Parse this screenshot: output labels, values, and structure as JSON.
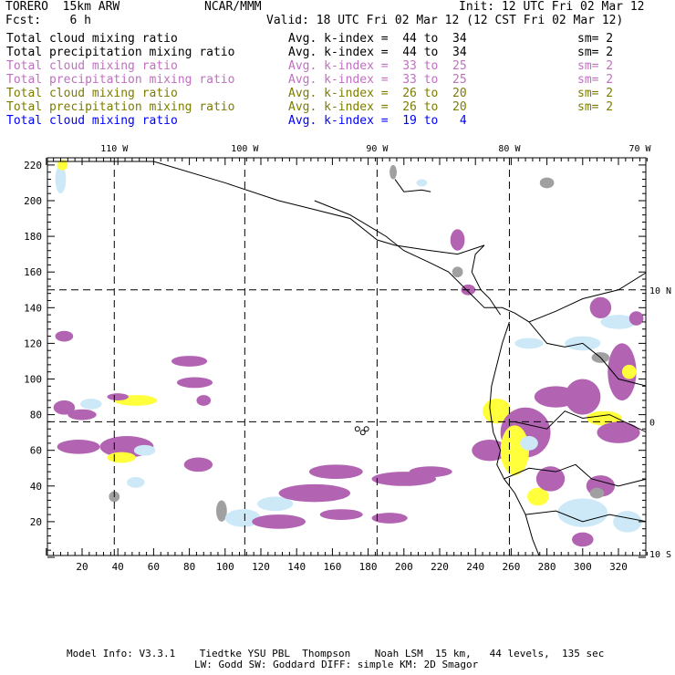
{
  "header": {
    "title": "TORERO  15km ARW",
    "org": "NCAR/MMM",
    "init": "Init: 12 UTC Fri 02 Mar 12",
    "fcst": "Fcst:    6 h",
    "valid": "Valid: 18 UTC Fri 02 Mar 12 (12 CST Fri 02 Mar 12)"
  },
  "legend": [
    {
      "field": "Total cloud mixing ratio",
      "range": "Avg. k-index =  44 to  34",
      "sm": "sm= 2",
      "color": "#000000"
    },
    {
      "field": "Total precipitation mixing ratio",
      "range": "Avg. k-index =  44 to  34",
      "sm": "sm= 2",
      "color": "#000000"
    },
    {
      "field": "Total cloud mixing ratio",
      "range": "Avg. k-index =  33 to  25",
      "sm": "sm= 2",
      "color": "#c070c0"
    },
    {
      "field": "Total precipitation mixing ratio",
      "range": "Avg. k-index =  33 to  25",
      "sm": "sm= 2",
      "color": "#c070c0"
    },
    {
      "field": "Total cloud mixing ratio",
      "range": "Avg. k-index =  26 to  20",
      "sm": "sm= 2",
      "color": "#7c7c00"
    },
    {
      "field": "Total precipitation mixing ratio",
      "range": "Avg. k-index =  26 to  20",
      "sm": "sm= 2",
      "color": "#7c7c00"
    },
    {
      "field": "Total cloud mixing ratio",
      "range": "Avg. k-index =  19 to   4",
      "sm": "",
      "color": "#0000ff"
    }
  ],
  "chart_data": {
    "type": "heatmap",
    "x_ticks": [
      20,
      40,
      60,
      80,
      100,
      120,
      140,
      160,
      180,
      200,
      220,
      240,
      260,
      280,
      300,
      320
    ],
    "y_ticks": [
      20,
      40,
      60,
      80,
      100,
      120,
      140,
      160,
      180,
      200,
      220
    ],
    "xlim": [
      0,
      336
    ],
    "ylim": [
      0,
      223
    ],
    "lon_labels": [
      {
        "label": "110 W",
        "x": 38
      },
      {
        "label": "100 W",
        "x": 111
      },
      {
        "label": "90 W",
        "x": 185
      },
      {
        "label": "80 W",
        "x": 259
      },
      {
        "label": "70 W",
        "x": 332
      }
    ],
    "lat_labels": [
      {
        "label": "10 N",
        "y": 150
      },
      {
        "label": "0",
        "y": 76
      },
      {
        "label": "10 S",
        "y": 2
      }
    ],
    "grid_lines_x": [
      38,
      111,
      185,
      259
    ],
    "grid_lines_y": [
      150,
      76
    ],
    "colors": {
      "purple": "#b264b2",
      "yellow": "#ffff3c",
      "blue": "#cde9f8",
      "gray": "#a0a0a0"
    },
    "fields": [
      {
        "c": "purple",
        "x": 10,
        "y": 84,
        "rx": 6,
        "ry": 4
      },
      {
        "c": "purple",
        "x": 20,
        "y": 80,
        "rx": 8,
        "ry": 3
      },
      {
        "c": "blue",
        "x": 25,
        "y": 86,
        "rx": 6,
        "ry": 3
      },
      {
        "c": "yellow",
        "x": 50,
        "y": 88,
        "rx": 12,
        "ry": 3
      },
      {
        "c": "purple",
        "x": 40,
        "y": 90,
        "rx": 6,
        "ry": 2
      },
      {
        "c": "purple",
        "x": 10,
        "y": 124,
        "rx": 5,
        "ry": 3
      },
      {
        "c": "purple",
        "x": 80,
        "y": 110,
        "rx": 10,
        "ry": 3
      },
      {
        "c": "purple",
        "x": 83,
        "y": 98,
        "rx": 10,
        "ry": 3
      },
      {
        "c": "purple",
        "x": 88,
        "y": 88,
        "rx": 4,
        "ry": 3
      },
      {
        "c": "purple",
        "x": 18,
        "y": 62,
        "rx": 12,
        "ry": 4
      },
      {
        "c": "purple",
        "x": 45,
        "y": 62,
        "rx": 15,
        "ry": 6
      },
      {
        "c": "yellow",
        "x": 42,
        "y": 56,
        "rx": 8,
        "ry": 3
      },
      {
        "c": "blue",
        "x": 55,
        "y": 60,
        "rx": 6,
        "ry": 3
      },
      {
        "c": "blue",
        "x": 50,
        "y": 42,
        "rx": 5,
        "ry": 3
      },
      {
        "c": "purple",
        "x": 85,
        "y": 52,
        "rx": 8,
        "ry": 4
      },
      {
        "c": "gray",
        "x": 38,
        "y": 34,
        "rx": 3,
        "ry": 3
      },
      {
        "c": "gray",
        "x": 98,
        "y": 26,
        "rx": 3,
        "ry": 6
      },
      {
        "c": "blue",
        "x": 110,
        "y": 22,
        "rx": 10,
        "ry": 5
      },
      {
        "c": "blue",
        "x": 128,
        "y": 30,
        "rx": 10,
        "ry": 4
      },
      {
        "c": "purple",
        "x": 150,
        "y": 36,
        "rx": 20,
        "ry": 5
      },
      {
        "c": "purple",
        "x": 130,
        "y": 20,
        "rx": 15,
        "ry": 4
      },
      {
        "c": "purple",
        "x": 165,
        "y": 24,
        "rx": 12,
        "ry": 3
      },
      {
        "c": "purple",
        "x": 200,
        "y": 44,
        "rx": 18,
        "ry": 4
      },
      {
        "c": "purple",
        "x": 215,
        "y": 48,
        "rx": 12,
        "ry": 3
      },
      {
        "c": "purple",
        "x": 162,
        "y": 48,
        "rx": 15,
        "ry": 4
      },
      {
        "c": "purple",
        "x": 192,
        "y": 22,
        "rx": 10,
        "ry": 3
      },
      {
        "c": "purple",
        "x": 248,
        "y": 60,
        "rx": 10,
        "ry": 6
      },
      {
        "c": "yellow",
        "x": 252,
        "y": 82,
        "rx": 8,
        "ry": 7
      },
      {
        "c": "purple",
        "x": 268,
        "y": 70,
        "rx": 14,
        "ry": 14
      },
      {
        "c": "yellow",
        "x": 262,
        "y": 60,
        "rx": 8,
        "ry": 14
      },
      {
        "c": "blue",
        "x": 270,
        "y": 64,
        "rx": 5,
        "ry": 4
      },
      {
        "c": "purple",
        "x": 285,
        "y": 90,
        "rx": 12,
        "ry": 6
      },
      {
        "c": "yellow",
        "x": 275,
        "y": 34,
        "rx": 6,
        "ry": 5
      },
      {
        "c": "purple",
        "x": 282,
        "y": 44,
        "rx": 8,
        "ry": 7
      },
      {
        "c": "purple",
        "x": 300,
        "y": 90,
        "rx": 10,
        "ry": 10
      },
      {
        "c": "blue",
        "x": 300,
        "y": 120,
        "rx": 10,
        "ry": 4
      },
      {
        "c": "purple",
        "x": 322,
        "y": 104,
        "rx": 8,
        "ry": 16
      },
      {
        "c": "yellow",
        "x": 326,
        "y": 104,
        "rx": 4,
        "ry": 4
      },
      {
        "c": "yellow",
        "x": 312,
        "y": 78,
        "rx": 10,
        "ry": 4
      },
      {
        "c": "purple",
        "x": 320,
        "y": 70,
        "rx": 12,
        "ry": 6
      },
      {
        "c": "blue",
        "x": 270,
        "y": 120,
        "rx": 8,
        "ry": 3
      },
      {
        "c": "blue",
        "x": 320,
        "y": 132,
        "rx": 10,
        "ry": 4
      },
      {
        "c": "gray",
        "x": 310,
        "y": 112,
        "rx": 5,
        "ry": 3
      },
      {
        "c": "purple",
        "x": 330,
        "y": 134,
        "rx": 4,
        "ry": 4
      },
      {
        "c": "purple",
        "x": 310,
        "y": 140,
        "rx": 6,
        "ry": 6
      },
      {
        "c": "purple",
        "x": 310,
        "y": 40,
        "rx": 8,
        "ry": 6
      },
      {
        "c": "blue",
        "x": 300,
        "y": 25,
        "rx": 14,
        "ry": 8
      },
      {
        "c": "gray",
        "x": 308,
        "y": 36,
        "rx": 4,
        "ry": 3
      },
      {
        "c": "purple",
        "x": 300,
        "y": 10,
        "rx": 6,
        "ry": 4
      },
      {
        "c": "blue",
        "x": 325,
        "y": 20,
        "rx": 8,
        "ry": 6
      },
      {
        "c": "purple",
        "x": 230,
        "y": 178,
        "rx": 4,
        "ry": 6
      },
      {
        "c": "gray",
        "x": 230,
        "y": 160,
        "rx": 3,
        "ry": 3
      },
      {
        "c": "purple",
        "x": 236,
        "y": 150,
        "rx": 4,
        "ry": 3
      },
      {
        "c": "gray",
        "x": 280,
        "y": 210,
        "rx": 4,
        "ry": 3
      },
      {
        "c": "blue",
        "x": 8,
        "y": 212,
        "rx": 3,
        "ry": 8
      },
      {
        "c": "yellow",
        "x": 9,
        "y": 220,
        "rx": 3,
        "ry": 3
      },
      {
        "c": "blue",
        "x": 210,
        "y": 210,
        "rx": 3,
        "ry": 2
      },
      {
        "c": "gray",
        "x": 194,
        "y": 216,
        "rx": 2,
        "ry": 4
      }
    ]
  },
  "footer": {
    "line1": "Model Info: V3.3.1    Tiedtke YSU PBL  Thompson    Noah LSM  15 km,   44 levels,  135 sec",
    "line2": "LW: Godd SW: Goddard DIFF: simple KM: 2D Smagor"
  }
}
